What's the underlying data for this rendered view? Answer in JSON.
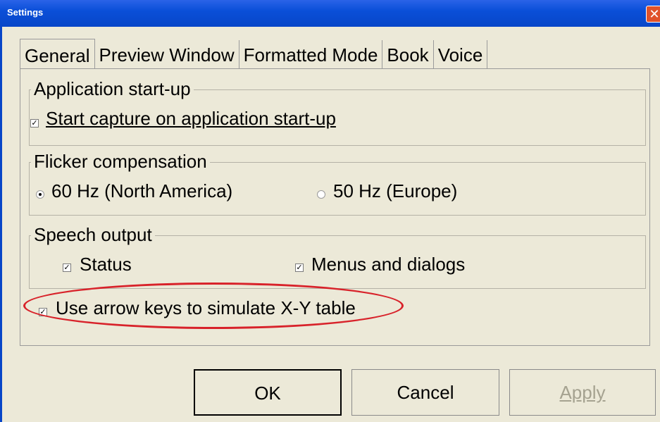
{
  "window": {
    "title": "Settings",
    "close_glyph": "✕"
  },
  "tabs": [
    {
      "label": "General"
    },
    {
      "label": "Preview Window"
    },
    {
      "label": "Formatted Mode"
    },
    {
      "label": "Book"
    },
    {
      "label": "Voice"
    }
  ],
  "groups": {
    "startup": {
      "title": "Application start-up",
      "option": {
        "label": "Start capture on application start-up",
        "checked": true
      }
    },
    "flicker": {
      "title": "Flicker compensation",
      "options": [
        {
          "label": "60 Hz (North America)",
          "selected": true
        },
        {
          "label": "50 Hz (Europe)",
          "selected": false
        }
      ]
    },
    "speech": {
      "title": "Speech output",
      "options": [
        {
          "label": "Status",
          "checked": true
        },
        {
          "label": "Menus and dialogs",
          "checked": true
        }
      ]
    }
  },
  "arrow_keys": {
    "label": "Use arrow keys to simulate X-Y table",
    "checked": true,
    "highlight_color": "#d8222a"
  },
  "buttons": {
    "ok": "OK",
    "cancel": "Cancel",
    "apply": "Apply"
  },
  "colors": {
    "titlebar": "#0846c8",
    "dialog_bg": "#ece9d8",
    "close": "#e0522a"
  },
  "icons": {
    "close": "close-icon",
    "check": "checkmark-icon",
    "radio": "radio-icon"
  }
}
